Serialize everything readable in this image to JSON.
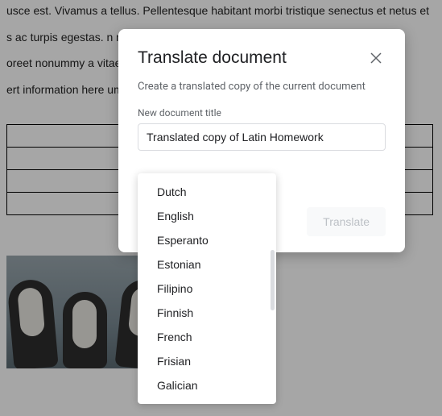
{
  "background": {
    "line1": "usce est. Vivamus a tellus. Pellentesque habitant morbi tristique senectus et netus et",
    "line2": "s ac turpis egestas. n nec lorem",
    "line3": "oreet nonummy a vitae, pretiu",
    "line4": "ert information here ummy."
  },
  "dialog": {
    "title": "Translate document",
    "subtitle": "Create a translated copy of the current document",
    "field_label": "New document title",
    "input_value": "Translated copy of Latin Homework",
    "translate_label": "Translate"
  },
  "language_options": [
    "Dutch",
    "English",
    "Esperanto",
    "Estonian",
    "Filipino",
    "Finnish",
    "French",
    "Frisian",
    "Galician"
  ]
}
